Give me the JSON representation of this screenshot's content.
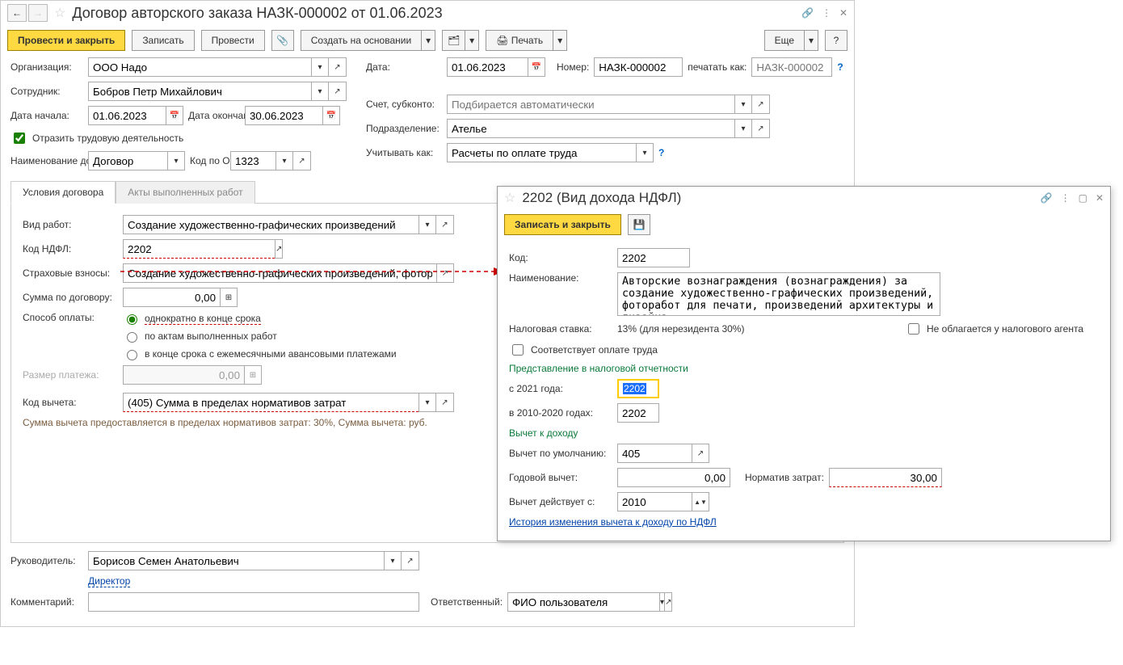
{
  "main": {
    "title": "Договор авторского заказа НАЗК-000002 от 01.06.2023",
    "toolbar": {
      "post_close": "Провести и закрыть",
      "save": "Записать",
      "post": "Провести",
      "create_based": "Создать на основании",
      "print": "Печать",
      "more": "Еще"
    },
    "fields": {
      "org_label": "Организация:",
      "org_value": "ООО Надо",
      "date_label": "Дата:",
      "date_value": "01.06.2023",
      "number_label": "Номер:",
      "number_value": "НАЗК-000002",
      "print_as_label": "печатать как:",
      "print_as_placeholder": "НАЗК-000002",
      "employee_label": "Сотрудник:",
      "employee_value": "Бобров Петр Михайлович",
      "start_label": "Дата начала:",
      "start_value": "01.06.2023",
      "end_label": "Дата окончания:",
      "end_value": "30.06.2023",
      "account_label": "Счет, субконто:",
      "account_placeholder": "Подбирается автоматически",
      "dept_label": "Подразделение:",
      "dept_value": "Ателье",
      "reflect_label": "Отразить трудовую деятельность",
      "treat_as_label": "Учитывать как:",
      "treat_as_value": "Расчеты по оплате труда",
      "doc_name_label": "Наименование документа:",
      "doc_name_value": "Договор",
      "okz_label": "Код по ОКЗ:",
      "okz_value": "1323"
    },
    "tabs": {
      "tab1": "Условия договора",
      "tab2": "Акты выполненных работ"
    },
    "contract": {
      "work_type_label": "Вид работ:",
      "work_type_value": "Создание художественно-графических произведений",
      "ndfl_code_label": "Код НДФЛ:",
      "ndfl_code_value": "2202",
      "insurance_label": "Страховые взносы:",
      "insurance_value": "Создание художественно-графических произведений, фотораб",
      "sum_label": "Сумма по договору:",
      "sum_value": "0,00",
      "pay_method_label": "Способ оплаты:",
      "pay_opt1": "однократно в конце срока",
      "pay_opt2": "по актам выполненных работ",
      "pay_opt3": "в конце срока с ежемесячными авансовыми платежами",
      "payment_size_label": "Размер платежа:",
      "payment_size_value": "0,00",
      "deduction_label": "Код вычета:",
      "deduction_value": "(405) Сумма в пределах нормативов затрат",
      "deduction_hint": "Сумма вычета предоставляется в пределах нормативов затрат: 30%,  Сумма вычета:  руб."
    },
    "footer": {
      "manager_label": "Руководитель:",
      "manager_value": "Борисов Семен Анатольевич",
      "position_link": "Директор",
      "comment_label": "Комментарий:",
      "responsible_label": "Ответственный:",
      "responsible_value": "ФИО пользователя"
    }
  },
  "popup": {
    "title": "2202 (Вид дохода НДФЛ)",
    "save_close": "Записать и закрыть",
    "code_label": "Код:",
    "code_value": "2202",
    "name_label": "Наименование:",
    "name_value": "Авторские вознаграждения (вознаграждения) за создание художественно-графических произведений, фоторабот для печати, произведений архитектуры и дизайна",
    "rate_label": "Налоговая ставка:",
    "rate_value": "13% (для нерезидента 30%)",
    "not_taxed_label": "Не облагается у налогового агента",
    "matches_pay_label": "Соответствует оплате труда",
    "tax_report_section": "Представление в налоговой отчетности",
    "since2021_label": "с 2021 года:",
    "since2021_value": "2202",
    "in2010_2020_label": "в 2010-2020 годах:",
    "in2010_2020_value": "2202",
    "deduction_section": "Вычет к доходу",
    "default_ded_label": "Вычет по умолчанию:",
    "default_ded_value": "405",
    "annual_ded_label": "Годовой вычет:",
    "annual_ded_value": "0,00",
    "norm_label": "Норматив затрат:",
    "norm_value": "30,00",
    "valid_from_label": "Вычет действует с:",
    "valid_from_value": "2010",
    "history_link": "История изменения вычета к доходу по НДФЛ"
  }
}
